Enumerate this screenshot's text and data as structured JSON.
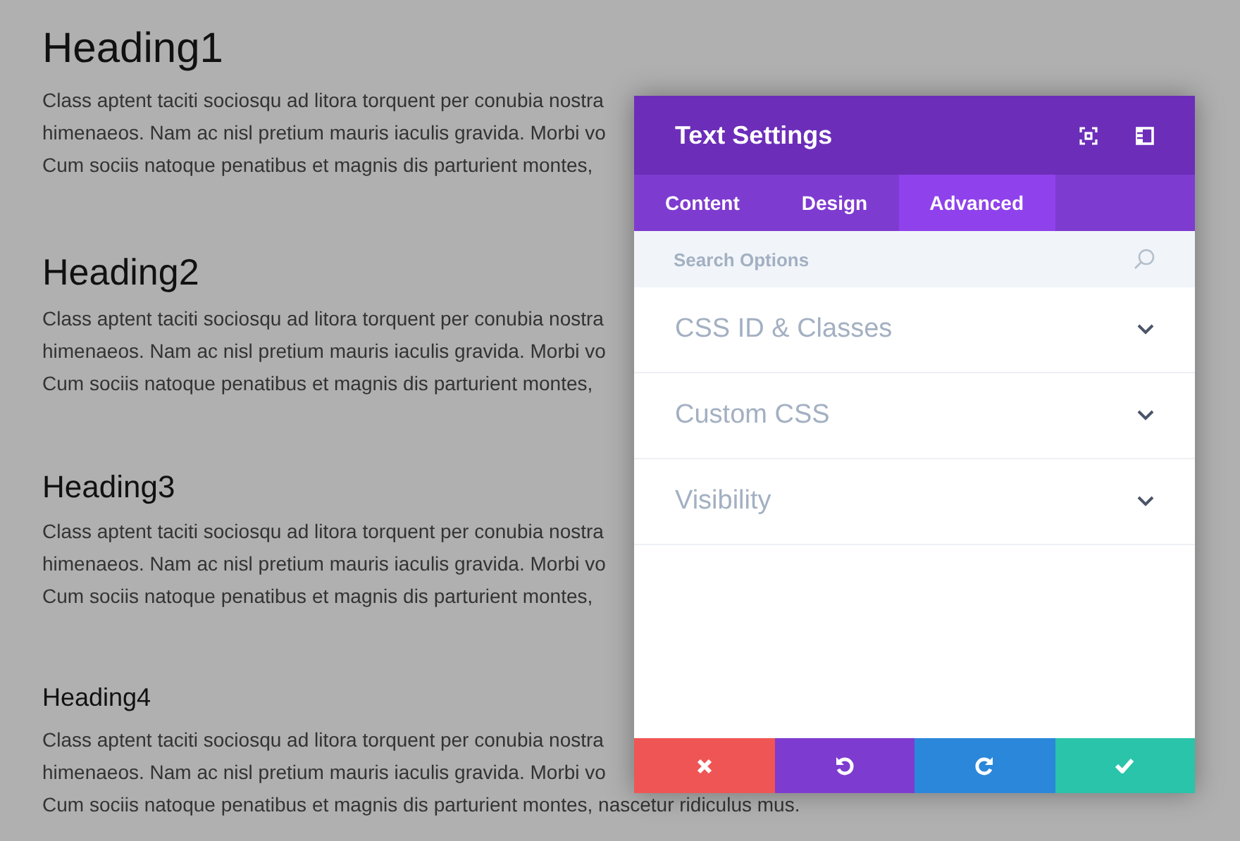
{
  "page": {
    "sections": [
      {
        "kind": "h1",
        "heading": "Heading1",
        "lines": [
          "Class aptent taciti sociosqu ad litora torquent per conubia nostra",
          "himenaeos. Nam ac nisl pretium mauris iaculis gravida. Morbi vo",
          "Cum sociis natoque penatibus et magnis dis parturient montes,"
        ]
      },
      {
        "kind": "h2",
        "heading": "Heading2",
        "lines": [
          "Class aptent taciti sociosqu ad litora torquent per conubia nostra",
          "himenaeos. Nam ac nisl pretium mauris iaculis gravida. Morbi vo",
          "Cum sociis natoque penatibus et magnis dis parturient montes,"
        ]
      },
      {
        "kind": "h3",
        "heading": "Heading3",
        "lines": [
          "Class aptent taciti sociosqu ad litora torquent per conubia nostra",
          "himenaeos. Nam ac nisl pretium mauris iaculis gravida. Morbi vo",
          "Cum sociis natoque penatibus et magnis dis parturient montes,"
        ]
      },
      {
        "kind": "h4",
        "heading": "Heading4",
        "lines": [
          "Class aptent taciti sociosqu ad litora torquent per conubia nostra",
          "himenaeos. Nam ac nisl pretium mauris iaculis gravida. Morbi vo",
          "Cum sociis natoque penatibus et magnis dis parturient montes, nascetur ridiculus mus."
        ]
      }
    ]
  },
  "modal": {
    "title": "Text Settings",
    "tabs": [
      {
        "label": "Content",
        "selected": false
      },
      {
        "label": "Design",
        "selected": false
      },
      {
        "label": "Advanced",
        "selected": true
      }
    ],
    "search": {
      "placeholder": "Search Options"
    },
    "groups": [
      {
        "label": "CSS ID & Classes",
        "expanded": false
      },
      {
        "label": "Custom CSS",
        "expanded": false
      },
      {
        "label": "Visibility",
        "expanded": false
      }
    ],
    "footer": [
      {
        "kind": "cancel"
      },
      {
        "kind": "undo"
      },
      {
        "kind": "redo"
      },
      {
        "kind": "save"
      }
    ]
  }
}
